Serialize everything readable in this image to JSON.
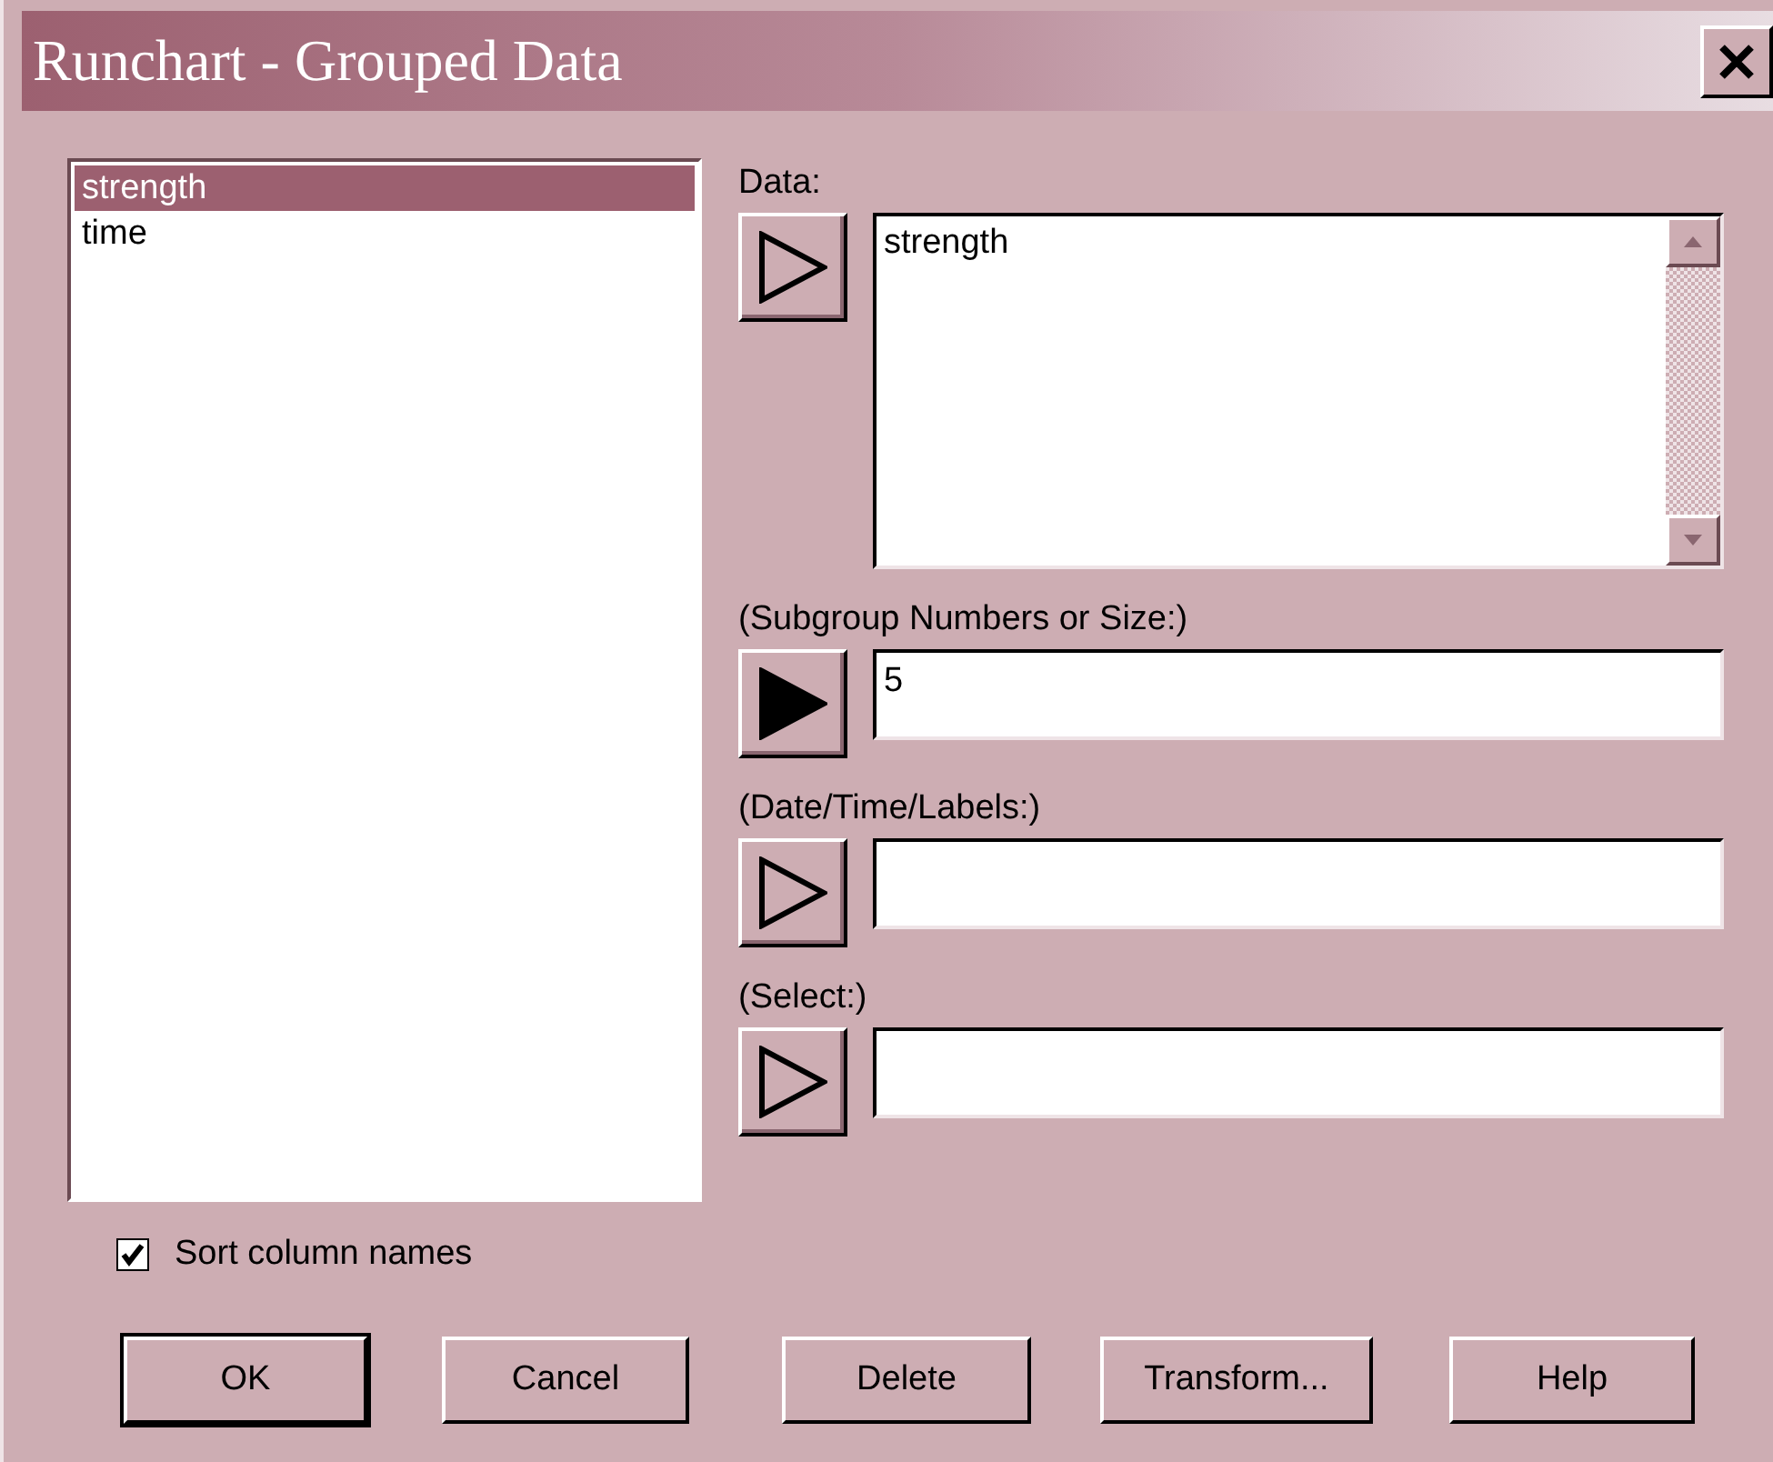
{
  "window": {
    "title": "Runchart - Grouped Data"
  },
  "columns": [
    {
      "label": "strength",
      "selected": true
    },
    {
      "label": "time",
      "selected": false
    }
  ],
  "inputs": [
    {
      "label": "Data:",
      "kind": "list",
      "arrow_active": false,
      "items": [
        "strength"
      ]
    },
    {
      "label": "(Subgroup Numbers or Size:)",
      "kind": "field",
      "arrow_active": true,
      "value": "5"
    },
    {
      "label": "(Date/Time/Labels:)",
      "kind": "field",
      "arrow_active": false
    },
    {
      "label": "(Select:)",
      "kind": "field",
      "arrow_active": false
    }
  ],
  "sort_column_names": {
    "label": "Sort column names",
    "checked": true
  },
  "buttons": [
    {
      "label": "OK",
      "default": true
    },
    {
      "label": "Cancel",
      "default": false
    },
    {
      "label": "Delete",
      "default": false
    },
    {
      "label": "Transform...",
      "default": false
    },
    {
      "label": "Help",
      "default": false
    }
  ]
}
